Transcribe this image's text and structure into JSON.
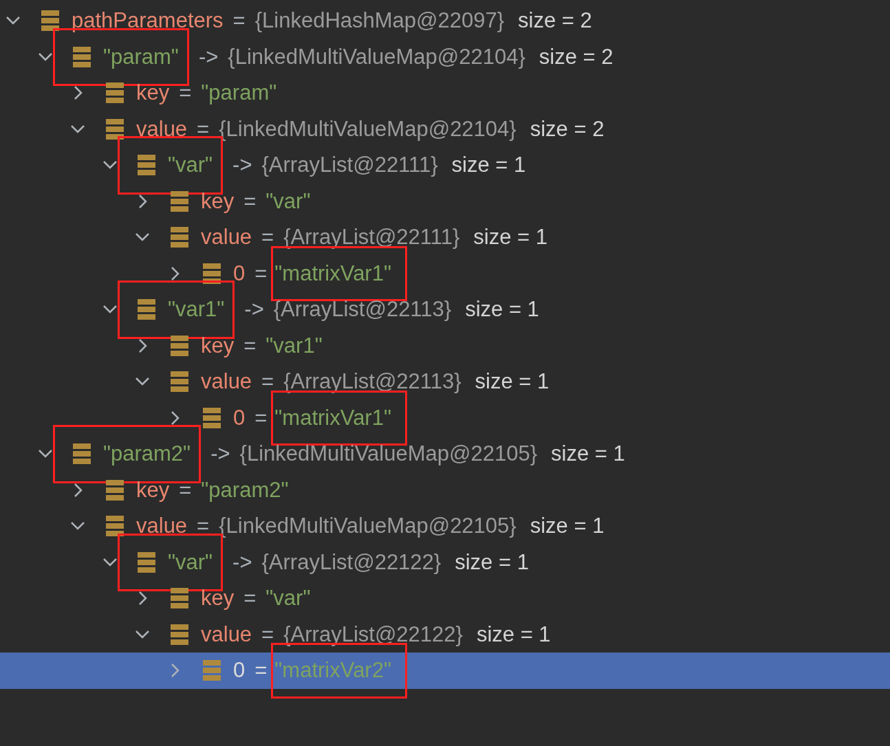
{
  "variables": [
    {
      "name": {
        "text": "pathParameters",
        "kind": "field",
        "boxed": false
      },
      "separator": "=",
      "value": {
        "text": "{LinkedHashMap@22097}",
        "kind": "object",
        "boxed": false
      },
      "size": "size = 2",
      "expanded": true,
      "selected": false,
      "children": [
        {
          "name": {
            "text": "\"param\"",
            "kind": "string",
            "boxed": true
          },
          "separator": "->",
          "value": {
            "text": "{LinkedMultiValueMap@22104}",
            "kind": "object",
            "boxed": false
          },
          "size": "size = 2",
          "expanded": true,
          "selected": false,
          "children": [
            {
              "name": {
                "text": "key",
                "kind": "field",
                "boxed": false
              },
              "separator": "=",
              "value": {
                "text": "\"param\"",
                "kind": "string",
                "boxed": false
              },
              "expanded": false,
              "selected": false
            },
            {
              "name": {
                "text": "value",
                "kind": "field",
                "boxed": false
              },
              "separator": "=",
              "value": {
                "text": "{LinkedMultiValueMap@22104}",
                "kind": "object",
                "boxed": false
              },
              "size": "size = 2",
              "expanded": true,
              "selected": false,
              "children": [
                {
                  "name": {
                    "text": "\"var\"",
                    "kind": "string",
                    "boxed": true
                  },
                  "separator": "->",
                  "value": {
                    "text": "{ArrayList@22111}",
                    "kind": "object",
                    "boxed": false
                  },
                  "size": "size = 1",
                  "expanded": true,
                  "selected": false,
                  "children": [
                    {
                      "name": {
                        "text": "key",
                        "kind": "field",
                        "boxed": false
                      },
                      "separator": "=",
                      "value": {
                        "text": "\"var\"",
                        "kind": "string",
                        "boxed": false
                      },
                      "expanded": false,
                      "selected": false
                    },
                    {
                      "name": {
                        "text": "value",
                        "kind": "field",
                        "boxed": false
                      },
                      "separator": "=",
                      "value": {
                        "text": "{ArrayList@22111}",
                        "kind": "object",
                        "boxed": false
                      },
                      "size": "size = 1",
                      "expanded": true,
                      "selected": false,
                      "children": [
                        {
                          "name": {
                            "text": "0",
                            "kind": "field",
                            "boxed": false
                          },
                          "separator": "=",
                          "value": {
                            "text": "\"matrixVar1\"",
                            "kind": "string",
                            "boxed": true
                          },
                          "expanded": false,
                          "selected": false
                        }
                      ]
                    }
                  ]
                },
                {
                  "name": {
                    "text": "\"var1\"",
                    "kind": "string",
                    "boxed": true
                  },
                  "separator": "->",
                  "value": {
                    "text": "{ArrayList@22113}",
                    "kind": "object",
                    "boxed": false
                  },
                  "size": "size = 1",
                  "expanded": true,
                  "selected": false,
                  "children": [
                    {
                      "name": {
                        "text": "key",
                        "kind": "field",
                        "boxed": false
                      },
                      "separator": "=",
                      "value": {
                        "text": "\"var1\"",
                        "kind": "string",
                        "boxed": false
                      },
                      "expanded": false,
                      "selected": false
                    },
                    {
                      "name": {
                        "text": "value",
                        "kind": "field",
                        "boxed": false
                      },
                      "separator": "=",
                      "value": {
                        "text": "{ArrayList@22113}",
                        "kind": "object",
                        "boxed": false
                      },
                      "size": "size = 1",
                      "expanded": true,
                      "selected": false,
                      "children": [
                        {
                          "name": {
                            "text": "0",
                            "kind": "field",
                            "boxed": false
                          },
                          "separator": "=",
                          "value": {
                            "text": "\"matrixVar1\"",
                            "kind": "string",
                            "boxed": true
                          },
                          "expanded": false,
                          "selected": false
                        }
                      ]
                    }
                  ]
                }
              ]
            }
          ]
        },
        {
          "name": {
            "text": "\"param2\"",
            "kind": "string",
            "boxed": true
          },
          "separator": "->",
          "value": {
            "text": "{LinkedMultiValueMap@22105}",
            "kind": "object",
            "boxed": false
          },
          "size": "size = 1",
          "expanded": true,
          "selected": false,
          "children": [
            {
              "name": {
                "text": "key",
                "kind": "field",
                "boxed": false
              },
              "separator": "=",
              "value": {
                "text": "\"param2\"",
                "kind": "string",
                "boxed": false
              },
              "expanded": false,
              "selected": false
            },
            {
              "name": {
                "text": "value",
                "kind": "field",
                "boxed": false
              },
              "separator": "=",
              "value": {
                "text": "{LinkedMultiValueMap@22105}",
                "kind": "object",
                "boxed": false
              },
              "size": "size = 1",
              "expanded": true,
              "selected": false,
              "children": [
                {
                  "name": {
                    "text": "\"var\"",
                    "kind": "string",
                    "boxed": true
                  },
                  "separator": "->",
                  "value": {
                    "text": "{ArrayList@22122}",
                    "kind": "object",
                    "boxed": false
                  },
                  "size": "size = 1",
                  "expanded": true,
                  "selected": false,
                  "children": [
                    {
                      "name": {
                        "text": "key",
                        "kind": "field",
                        "boxed": false
                      },
                      "separator": "=",
                      "value": {
                        "text": "\"var\"",
                        "kind": "string",
                        "boxed": false
                      },
                      "expanded": false,
                      "selected": false
                    },
                    {
                      "name": {
                        "text": "value",
                        "kind": "field",
                        "boxed": false
                      },
                      "separator": "=",
                      "value": {
                        "text": "{ArrayList@22122}",
                        "kind": "object",
                        "boxed": false
                      },
                      "size": "size = 1",
                      "expanded": true,
                      "selected": false,
                      "children": [
                        {
                          "name": {
                            "text": "0",
                            "kind": "field",
                            "boxed": false
                          },
                          "separator": "=",
                          "value": {
                            "text": "\"matrixVar2\"",
                            "kind": "string",
                            "boxed": true
                          },
                          "expanded": false,
                          "selected": true
                        }
                      ]
                    }
                  ]
                }
              ]
            }
          ]
        }
      ]
    }
  ]
}
